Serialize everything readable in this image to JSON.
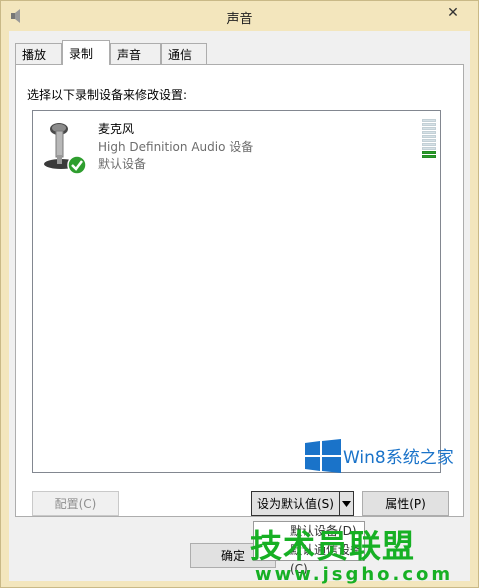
{
  "window": {
    "title": "声音",
    "close_label": "✕"
  },
  "tabs": [
    {
      "label": "播放",
      "active": false
    },
    {
      "label": "录制",
      "active": true
    },
    {
      "label": "声音",
      "active": false
    },
    {
      "label": "通信",
      "active": false
    }
  ],
  "recording": {
    "instruction": "选择以下录制设备来修改设置:",
    "device": {
      "name": "麦克风",
      "description": "High Definition Audio 设备",
      "status": "默认设备",
      "icon": "microphone-icon",
      "status_icon": "green-check-icon",
      "level_bars_total": 10,
      "level_bars_active": 2
    }
  },
  "buttons": {
    "configure": "配置(C)",
    "set_default": "设为默认值(S)",
    "properties": "属性(P)",
    "ok": "确定"
  },
  "menu": {
    "items": [
      "默认设备(D)",
      "默认通信设备(C)"
    ]
  },
  "watermarks": {
    "win8": "Win8系统之家",
    "site_name": "技术员联盟",
    "site_url": "www.jsgho.com"
  },
  "colors": {
    "title_bar": "#f3e6bd",
    "level_active": "#2a9c2a",
    "win8_blue": "#1a73c9",
    "watermark_green": "#17b024"
  }
}
